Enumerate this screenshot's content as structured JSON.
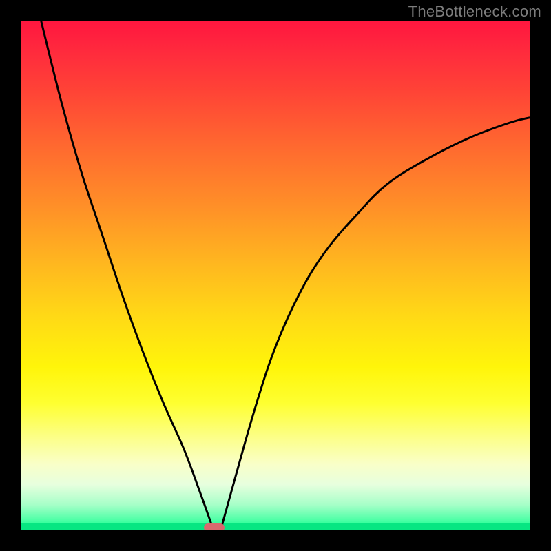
{
  "watermark": "TheBottleneck.com",
  "colors": {
    "background": "#000000",
    "curve_stroke": "#000000",
    "marker_fill": "#d86a6e",
    "gradient_top": "#ff163f",
    "gradient_bottom": "#00ff88"
  },
  "chart_data": {
    "type": "line",
    "title": "",
    "xlabel": "",
    "ylabel": "",
    "xlim": [
      0,
      100
    ],
    "ylim": [
      0,
      100
    ],
    "grid": false,
    "legend": null,
    "marker": {
      "x": 38,
      "y": 0.5,
      "width_pct": 4
    },
    "series": [
      {
        "name": "left-branch",
        "x": [
          4,
          8,
          12,
          16,
          20,
          24,
          28,
          32,
          35,
          37.5
        ],
        "y": [
          100,
          84,
          70,
          58,
          46,
          35,
          25,
          16,
          8,
          1
        ]
      },
      {
        "name": "right-branch",
        "x": [
          39.5,
          42,
          46,
          50,
          55,
          60,
          66,
          72,
          80,
          88,
          96,
          100
        ],
        "y": [
          1,
          10,
          24,
          36,
          47,
          55,
          62,
          68,
          73,
          77,
          80,
          81
        ]
      }
    ]
  }
}
